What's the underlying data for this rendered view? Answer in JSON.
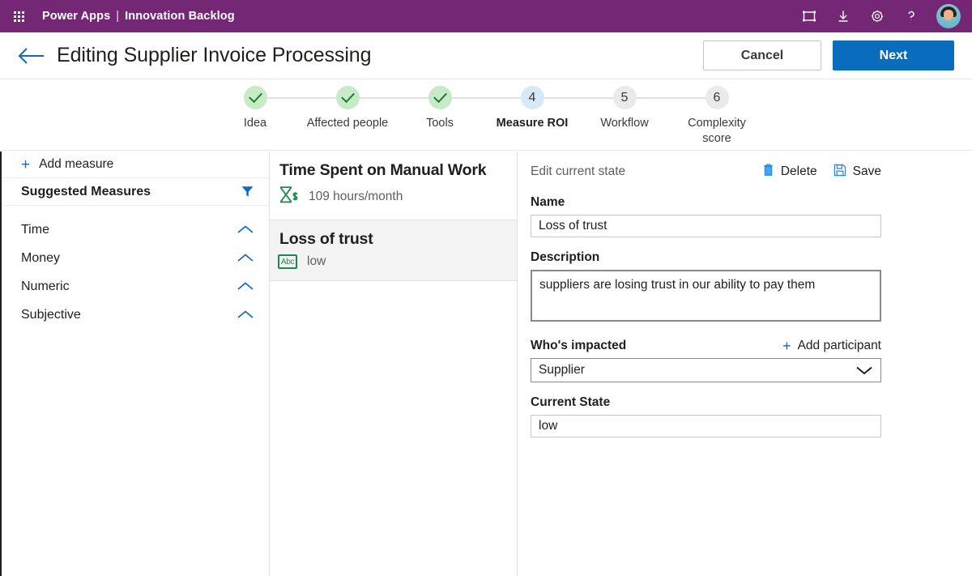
{
  "suite": {
    "waffle_icon": "app-launcher-icon",
    "brand": "Power Apps",
    "separator": "|",
    "app_name": "Innovation Backlog",
    "icons": [
      {
        "name": "frame-icon",
        "label": "Fit to screen"
      },
      {
        "name": "download-icon",
        "label": "Download"
      },
      {
        "name": "gear-icon",
        "label": "Settings"
      },
      {
        "name": "help-icon",
        "label": "Help"
      }
    ],
    "avatar_label": "Account manager"
  },
  "command_bar": {
    "back_icon": "back-arrow-icon",
    "title": "Editing Supplier Invoice Processing",
    "cancel_label": "Cancel",
    "next_label": "Next"
  },
  "stepper": {
    "steps": [
      {
        "num": "1",
        "label": "Idea",
        "state": "done"
      },
      {
        "num": "2",
        "label": "Affected people",
        "state": "done"
      },
      {
        "num": "3",
        "label": "Tools",
        "state": "done"
      },
      {
        "num": "4",
        "label": "Measure ROI",
        "state": "active"
      },
      {
        "num": "5",
        "label": "Workflow",
        "state": "todo"
      },
      {
        "num": "6",
        "label": "Complexity score",
        "state": "todo"
      }
    ]
  },
  "measures_panel": {
    "add_measure_label": "Add measure",
    "add_icon": "plus-icon",
    "suggested_title": "Suggested Measures",
    "filter_icon": "filter-icon",
    "categories": [
      {
        "label": "Time",
        "chevron": "chevron-up-icon"
      },
      {
        "label": "Money",
        "chevron": "chevron-up-icon"
      },
      {
        "label": "Numeric",
        "chevron": "chevron-up-icon"
      },
      {
        "label": "Subjective",
        "chevron": "chevron-up-icon"
      }
    ]
  },
  "cards_panel": {
    "cards": [
      {
        "title": "Time Spent on Manual Work",
        "value": "109 hours/month",
        "icon": "hourglass-dollar-icon",
        "icon_text": "",
        "selected": false
      },
      {
        "title": "Loss of trust",
        "value": "low",
        "icon": "abc-text-icon",
        "icon_text": "Abc",
        "selected": true
      }
    ]
  },
  "detail_panel": {
    "edit_state_label": "Edit current state",
    "delete_label": "Delete",
    "delete_icon": "trash-icon",
    "save_label": "Save",
    "save_icon": "save-disk-icon",
    "name_label": "Name",
    "name_value": "Loss of trust",
    "description_label": "Description",
    "description_value": "suppliers are losing trust in our ability to pay them",
    "impacted_label": "Who's impacted",
    "add_participant_label": "Add participant",
    "add_participant_icon": "plus-icon",
    "impacted_value": "Supplier",
    "impacted_options": [
      "Supplier"
    ],
    "impacted_chevron": "chevron-down-icon",
    "current_state_label": "Current State",
    "current_state_value": "low"
  },
  "colors": {
    "suite_purple": "#742774",
    "accent_blue": "#0a6cbd",
    "link_blue": "#1268c3",
    "done_green_bg": "#c6ebc6",
    "done_green_fg": "#1a7a34",
    "active_blue_bg": "#d7e8f7",
    "todo_gray_bg": "#eaeaea",
    "icon_green": "#1e8a4a",
    "selected_row_bg": "#f3f3f3"
  }
}
